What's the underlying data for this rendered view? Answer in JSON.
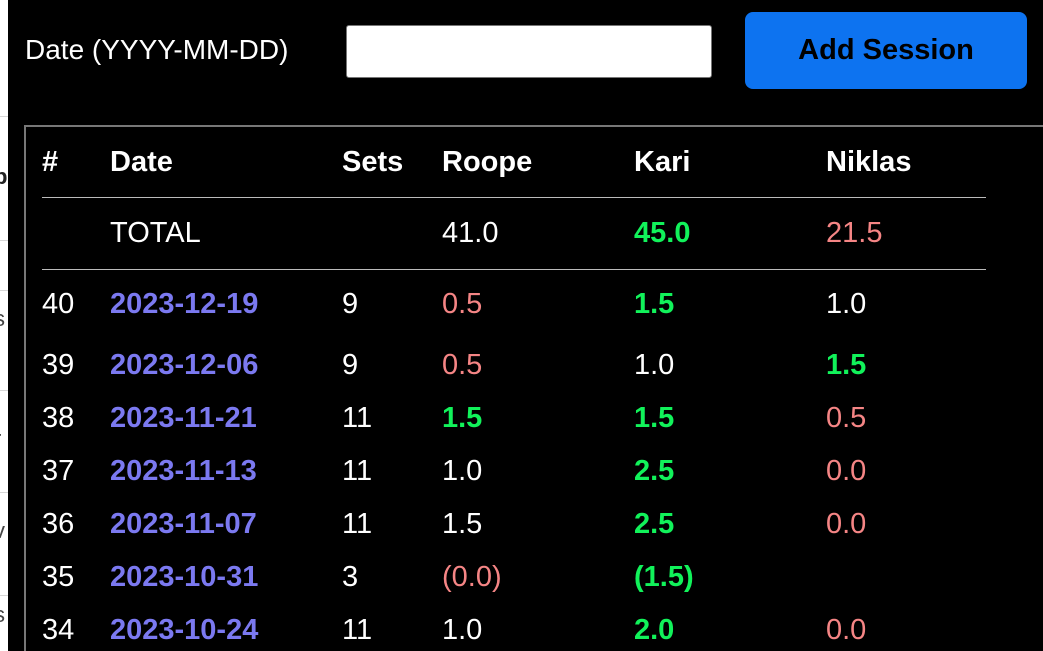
{
  "form": {
    "date_label": "Date (YYYY-MM-DD)",
    "date_value": "",
    "add_button_label": "Add Session"
  },
  "table": {
    "headers": [
      "#",
      "Date",
      "Sets",
      "Roope",
      "Kari",
      "Niklas"
    ],
    "total": {
      "label": "TOTAL",
      "roope": {
        "value": "41.0",
        "status": "neutral"
      },
      "kari": {
        "value": "45.0",
        "status": "win"
      },
      "niklas": {
        "value": "21.5",
        "status": "lose"
      }
    },
    "rows": [
      {
        "num": "40",
        "date": "2023-12-19",
        "sets": "9",
        "roope": {
          "value": "0.5",
          "status": "lose"
        },
        "kari": {
          "value": "1.5",
          "status": "win"
        },
        "niklas": {
          "value": "1.0",
          "status": "neutral"
        }
      },
      {
        "num": "39",
        "date": "2023-12-06",
        "sets": "9",
        "roope": {
          "value": "0.5",
          "status": "lose"
        },
        "kari": {
          "value": "1.0",
          "status": "neutral"
        },
        "niklas": {
          "value": "1.5",
          "status": "win"
        }
      },
      {
        "num": "38",
        "date": "2023-11-21",
        "sets": "11",
        "roope": {
          "value": "1.5",
          "status": "win"
        },
        "kari": {
          "value": "1.5",
          "status": "win"
        },
        "niklas": {
          "value": "0.5",
          "status": "lose"
        }
      },
      {
        "num": "37",
        "date": "2023-11-13",
        "sets": "11",
        "roope": {
          "value": "1.0",
          "status": "neutral"
        },
        "kari": {
          "value": "2.5",
          "status": "win"
        },
        "niklas": {
          "value": "0.0",
          "status": "lose"
        }
      },
      {
        "num": "36",
        "date": "2023-11-07",
        "sets": "11",
        "roope": {
          "value": "1.5",
          "status": "neutral"
        },
        "kari": {
          "value": "2.5",
          "status": "win"
        },
        "niklas": {
          "value": "0.0",
          "status": "lose"
        }
      },
      {
        "num": "35",
        "date": "2023-10-31",
        "sets": "3",
        "roope": {
          "value": "(0.0)",
          "status": "lose"
        },
        "kari": {
          "value": "(1.5)",
          "status": "win"
        },
        "niklas": {
          "value": "",
          "status": "neutral"
        }
      },
      {
        "num": "34",
        "date": "2023-10-24",
        "sets": "11",
        "roope": {
          "value": "1.0",
          "status": "neutral"
        },
        "kari": {
          "value": "2.0",
          "status": "win"
        },
        "niklas": {
          "value": "0.0",
          "status": "lose"
        }
      }
    ]
  },
  "colors": {
    "background": "#000000",
    "button": "#0d73f0",
    "date_link": "#7b79f0",
    "win": "#11f25a",
    "lose": "#f58585",
    "neutral": "#ffffff"
  }
}
